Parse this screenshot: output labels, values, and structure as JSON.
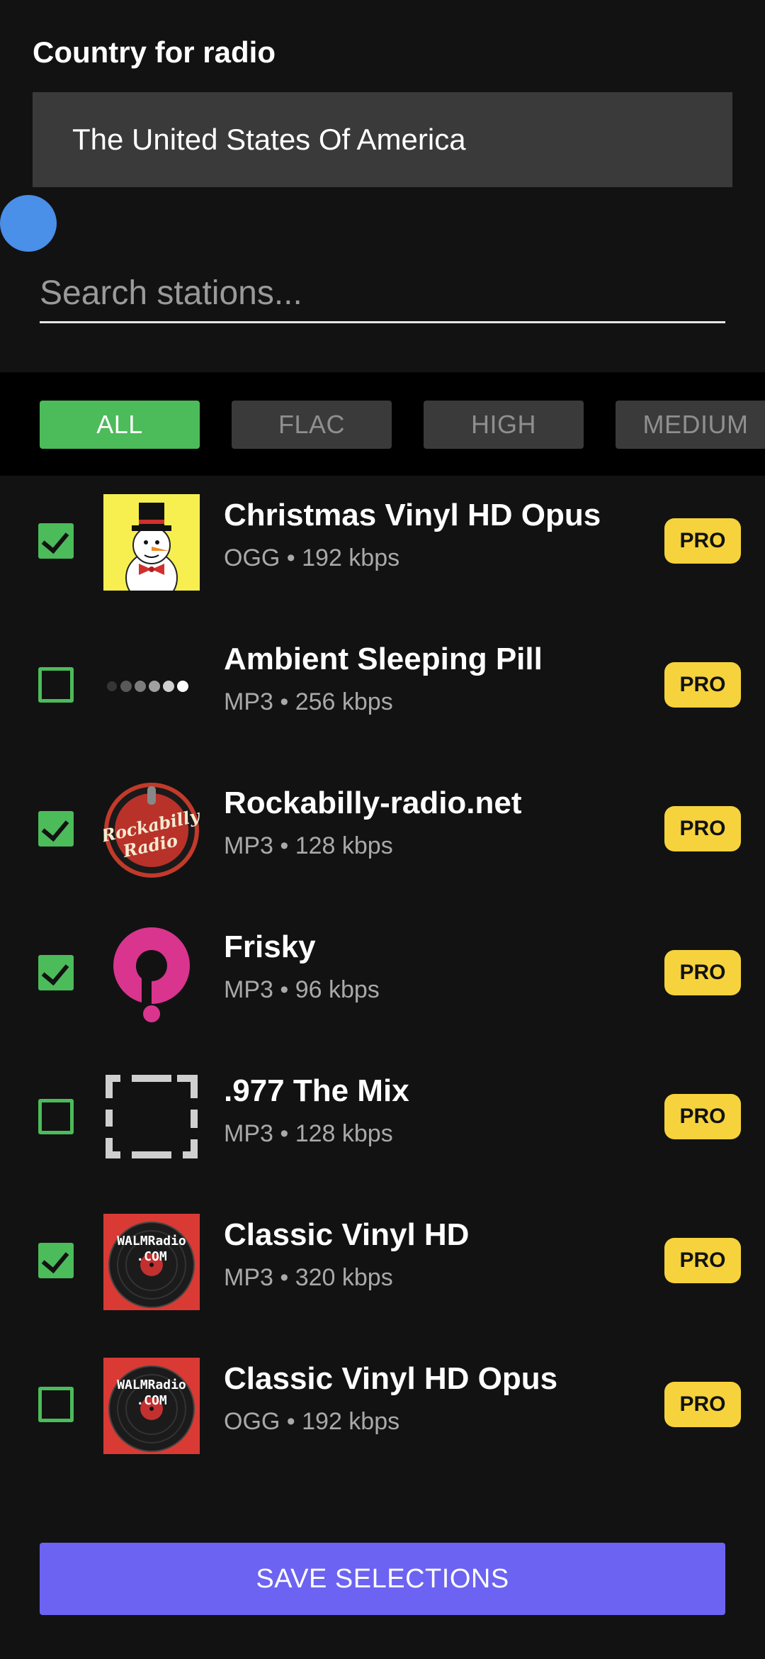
{
  "header": {
    "country_label": "Country for radio",
    "country_value": "The United States Of America"
  },
  "search": {
    "placeholder": "Search stations..."
  },
  "filters": [
    {
      "label": "ALL",
      "active": true
    },
    {
      "label": "FLAC",
      "active": false
    },
    {
      "label": "HIGH",
      "active": false
    },
    {
      "label": "MEDIUM",
      "active": false
    }
  ],
  "stations": [
    {
      "title": "Christmas Vinyl HD Opus",
      "sub": "OGG • 192 kbps",
      "checked": true,
      "badge": "PRO",
      "logo": "snowman-logo-icon"
    },
    {
      "title": "Ambient Sleeping Pill",
      "sub": "MP3 • 256 kbps",
      "checked": false,
      "badge": "PRO",
      "logo": "dots-logo-icon"
    },
    {
      "title": "Rockabilly-radio.net",
      "sub": "MP3 • 128 kbps",
      "checked": true,
      "badge": "PRO",
      "logo": "rockabilly-logo-icon"
    },
    {
      "title": "Frisky",
      "sub": "MP3 • 96 kbps",
      "checked": true,
      "badge": "PRO",
      "logo": "frisky-logo-icon"
    },
    {
      "title": ".977 The Mix",
      "sub": "MP3 • 128 kbps",
      "checked": false,
      "badge": "PRO",
      "logo": "placeholder-logo-icon"
    },
    {
      "title": "Classic Vinyl HD",
      "sub": "MP3 • 320 kbps",
      "checked": true,
      "badge": "PRO",
      "logo": "vinyl-logo-icon"
    },
    {
      "title": "Classic Vinyl HD Opus",
      "sub": "OGG • 192 kbps",
      "checked": false,
      "badge": "PRO",
      "logo": "vinyl-logo-icon"
    }
  ],
  "logo_text": {
    "rockabilly_line1": "Rockabilly",
    "rockabilly_line2": "Radio",
    "walm_line1": "WALMRadio",
    "walm_line2": ".COM"
  },
  "actions": {
    "save_label": "SAVE SELECTIONS"
  },
  "colors": {
    "background": "#121212",
    "accent_green": "#4cbb5a",
    "pro_badge": "#f6d33c",
    "save_button": "#6c63f2"
  }
}
